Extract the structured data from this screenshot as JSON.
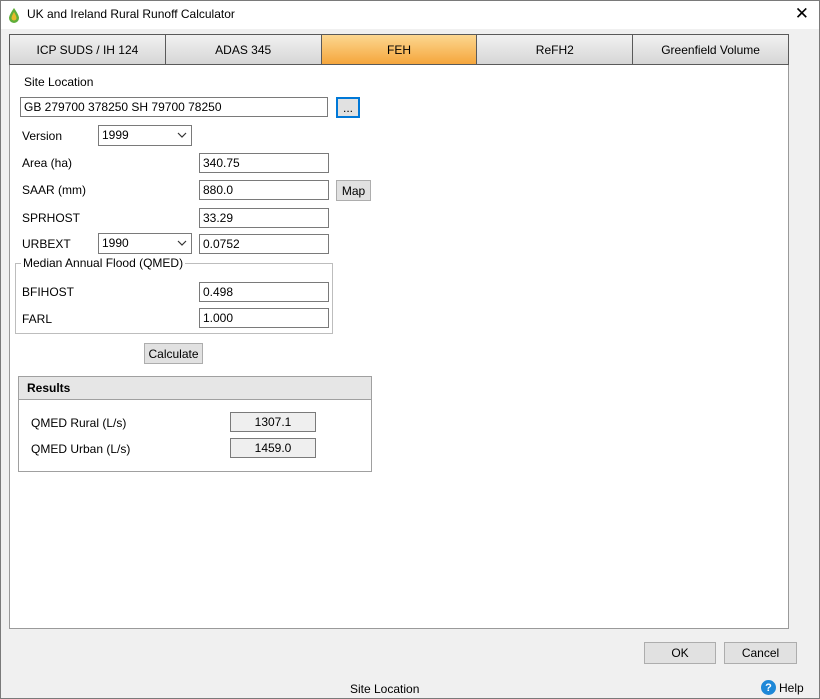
{
  "window": {
    "title": "UK and Ireland Rural Runoff Calculator",
    "close_glyph": "✕"
  },
  "tabs": [
    {
      "label": "ICP SUDS / IH 124",
      "active": false
    },
    {
      "label": "ADAS 345",
      "active": false
    },
    {
      "label": "FEH",
      "active": true
    },
    {
      "label": "ReFH2",
      "active": false
    },
    {
      "label": "Greenfield Volume",
      "active": false
    }
  ],
  "form": {
    "site_location_label": "Site Location",
    "site_location_value": "GB 279700 378250 SH 79700 78250",
    "browse_label": "...",
    "version_label": "Version",
    "version_value": "1999",
    "area_label": "Area (ha)",
    "area_value": "340.75",
    "saar_label": "SAAR (mm)",
    "saar_value": "880.0",
    "map_label": "Map",
    "sprhost_label": "SPRHOST",
    "sprhost_value": "33.29",
    "urbext_label": "URBEXT",
    "urbext_year": "1990",
    "urbext_value": "0.0752",
    "qmed_group_title": "Median Annual Flood (QMED)",
    "bfihost_label": "BFIHOST",
    "bfihost_value": "0.498",
    "farl_label": "FARL",
    "farl_value": "1.000",
    "calculate_label": "Calculate"
  },
  "results": {
    "header": "Results",
    "qmed_rural_label": "QMED Rural (L/s)",
    "qmed_rural_value": "1307.1",
    "qmed_urban_label": "QMED Urban (L/s)",
    "qmed_urban_value": "1459.0"
  },
  "footer": {
    "ok_label": "OK",
    "cancel_label": "Cancel",
    "status_text": "Site Location",
    "help_label": "Help",
    "help_glyph": "?"
  },
  "colors": {
    "active_tab": "#f5a63c",
    "focus_border": "#0078d7",
    "help_icon": "#1e88d8"
  }
}
